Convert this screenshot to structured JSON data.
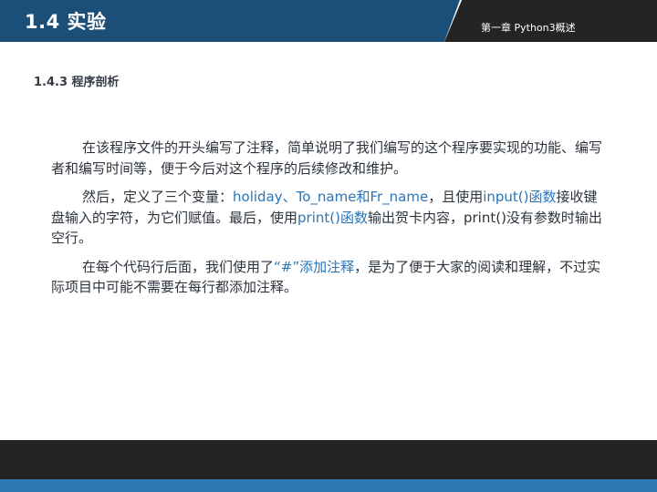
{
  "header": {
    "title": "1.4 实验",
    "chapter": "第一章  Python3概述"
  },
  "section": {
    "heading": "1.4.3 程序剖析"
  },
  "paragraphs": {
    "p1": {
      "text": "在该程序文件的开头编写了注释，简单说明了我们编写的这个程序要实现的功能、编写者和编写时间等，便于今后对这个程序的后续修改和维护。"
    },
    "p2": {
      "t1": "然后，定义了三个变量：",
      "h1": "holiday、To_name和Fr_name",
      "t2": "，且使用",
      "h2": "input()函数",
      "t3": "接收键盘输入的字符，为它们赋值。最后，使用",
      "h3": "print()函数",
      "t4": "输出贺卡内容，print()没有参数时输出空行。"
    },
    "p3": {
      "t1": "在每个代码行后面，我们使用了",
      "h1": "“#”添加注释",
      "t2": "，是为了便于大家的阅读和理解，不过实际项目中可能不需要在每行都添加注释。"
    }
  },
  "colors": {
    "header_blue": "#1c4f78",
    "dark_bar": "#242424",
    "footer_blue": "#2f78b5",
    "highlight_text": "#2a74b8",
    "body_text": "#2c333c"
  }
}
